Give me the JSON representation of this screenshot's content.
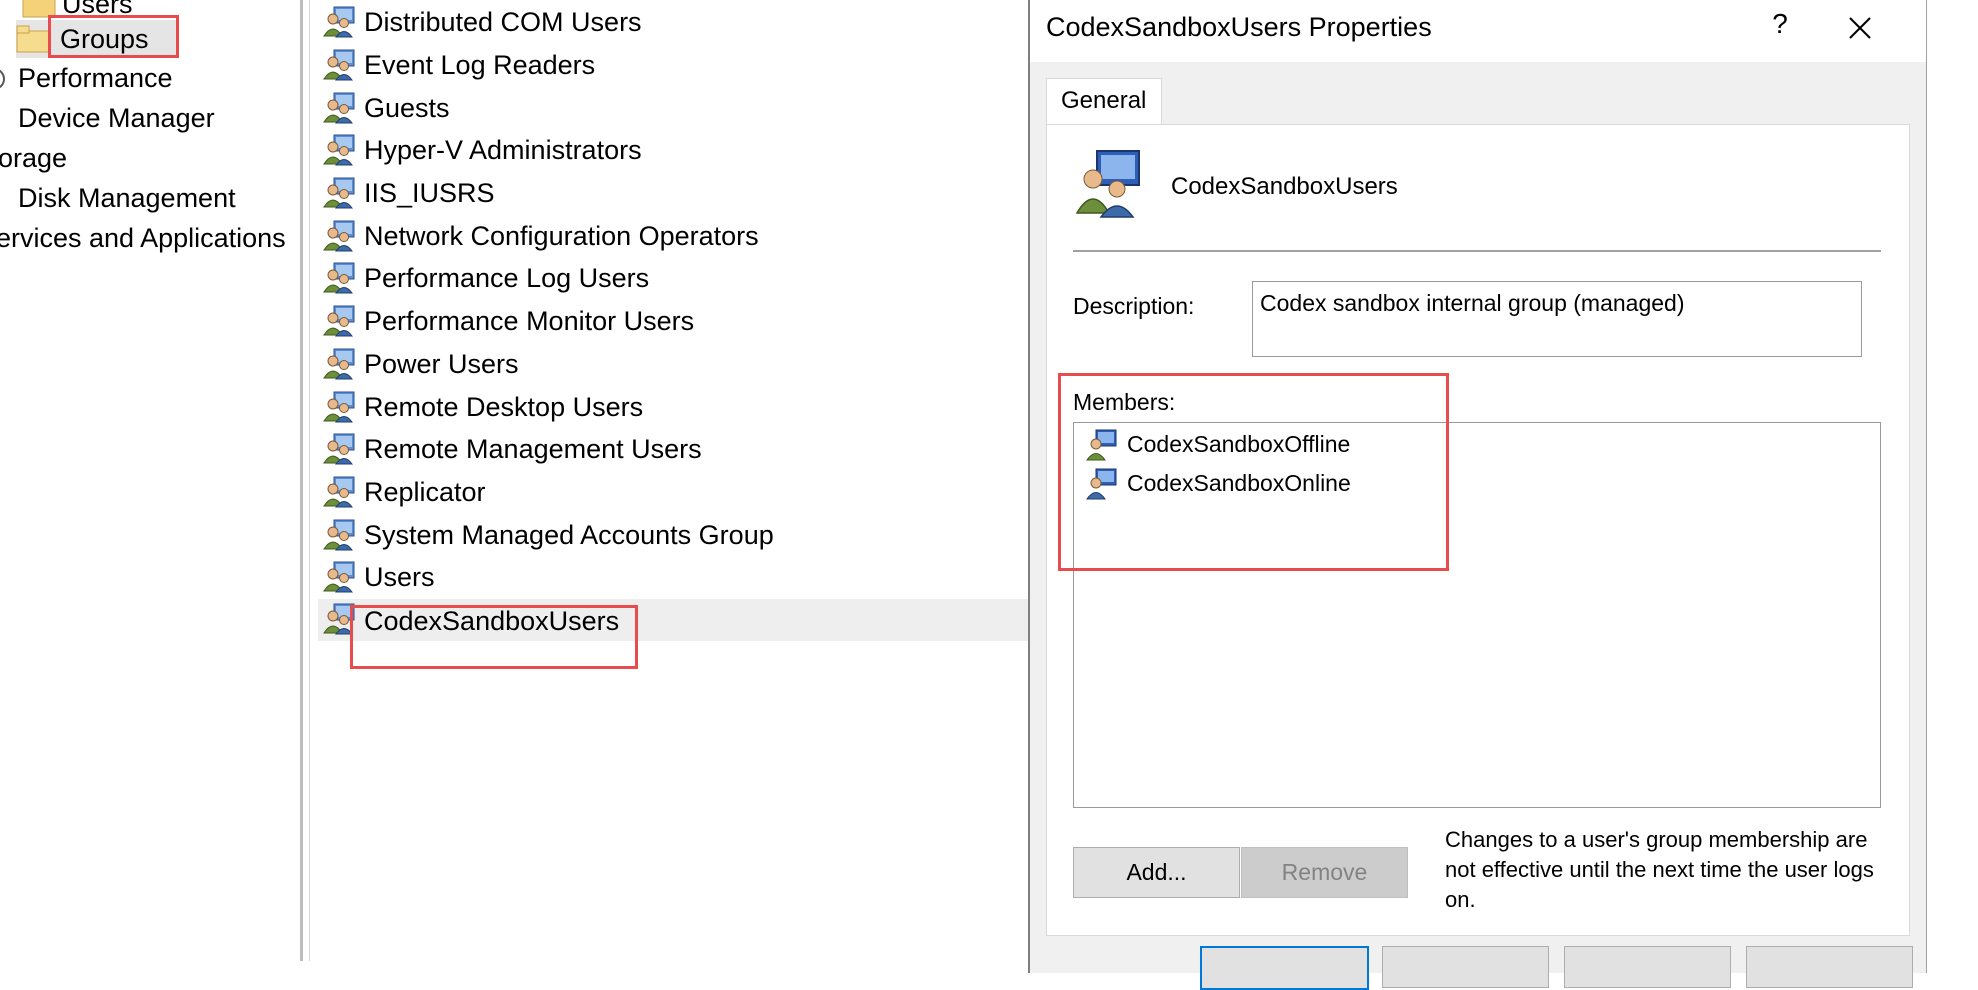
{
  "tree": {
    "items": [
      {
        "label": "Users"
      },
      {
        "label": "Groups"
      },
      {
        "label": "Performance"
      },
      {
        "label": "Device Manager"
      },
      {
        "label": "orage"
      },
      {
        "label": "Disk Management"
      },
      {
        "label": "ervices and Applications"
      }
    ]
  },
  "groups": [
    {
      "label": "Distributed COM Users"
    },
    {
      "label": "Event Log Readers"
    },
    {
      "label": "Guests"
    },
    {
      "label": "Hyper-V Administrators"
    },
    {
      "label": "IIS_IUSRS"
    },
    {
      "label": "Network Configuration Operators"
    },
    {
      "label": "Performance Log Users"
    },
    {
      "label": "Performance Monitor Users"
    },
    {
      "label": "Power Users"
    },
    {
      "label": "Remote Desktop Users"
    },
    {
      "label": "Remote Management Users"
    },
    {
      "label": "Replicator"
    },
    {
      "label": "System Managed Accounts Group"
    },
    {
      "label": "Users"
    },
    {
      "label": "CodexSandboxUsers"
    }
  ],
  "dialog": {
    "title": "CodexSandboxUsers Properties",
    "help": "?",
    "tab": "General",
    "group_name": "CodexSandboxUsers",
    "description_label": "Description:",
    "description_value": "Codex sandbox internal group (managed)",
    "members_label": "Members:",
    "members": [
      {
        "label": "CodexSandboxOffline"
      },
      {
        "label": "CodexSandboxOnline"
      }
    ],
    "add_label": "Add...",
    "remove_label": "Remove",
    "note": "Changes to a user's group membership are not effective until the next time the user logs on."
  },
  "colors": {
    "annotation": "#e84c4c",
    "selection": "#eeeeee",
    "dialog_bg": "#f0f0f0",
    "focus": "#0078d7"
  },
  "icons": {
    "folder": "folder-icon",
    "group": "group-icon",
    "user": "user-icon",
    "close": "close-icon"
  }
}
